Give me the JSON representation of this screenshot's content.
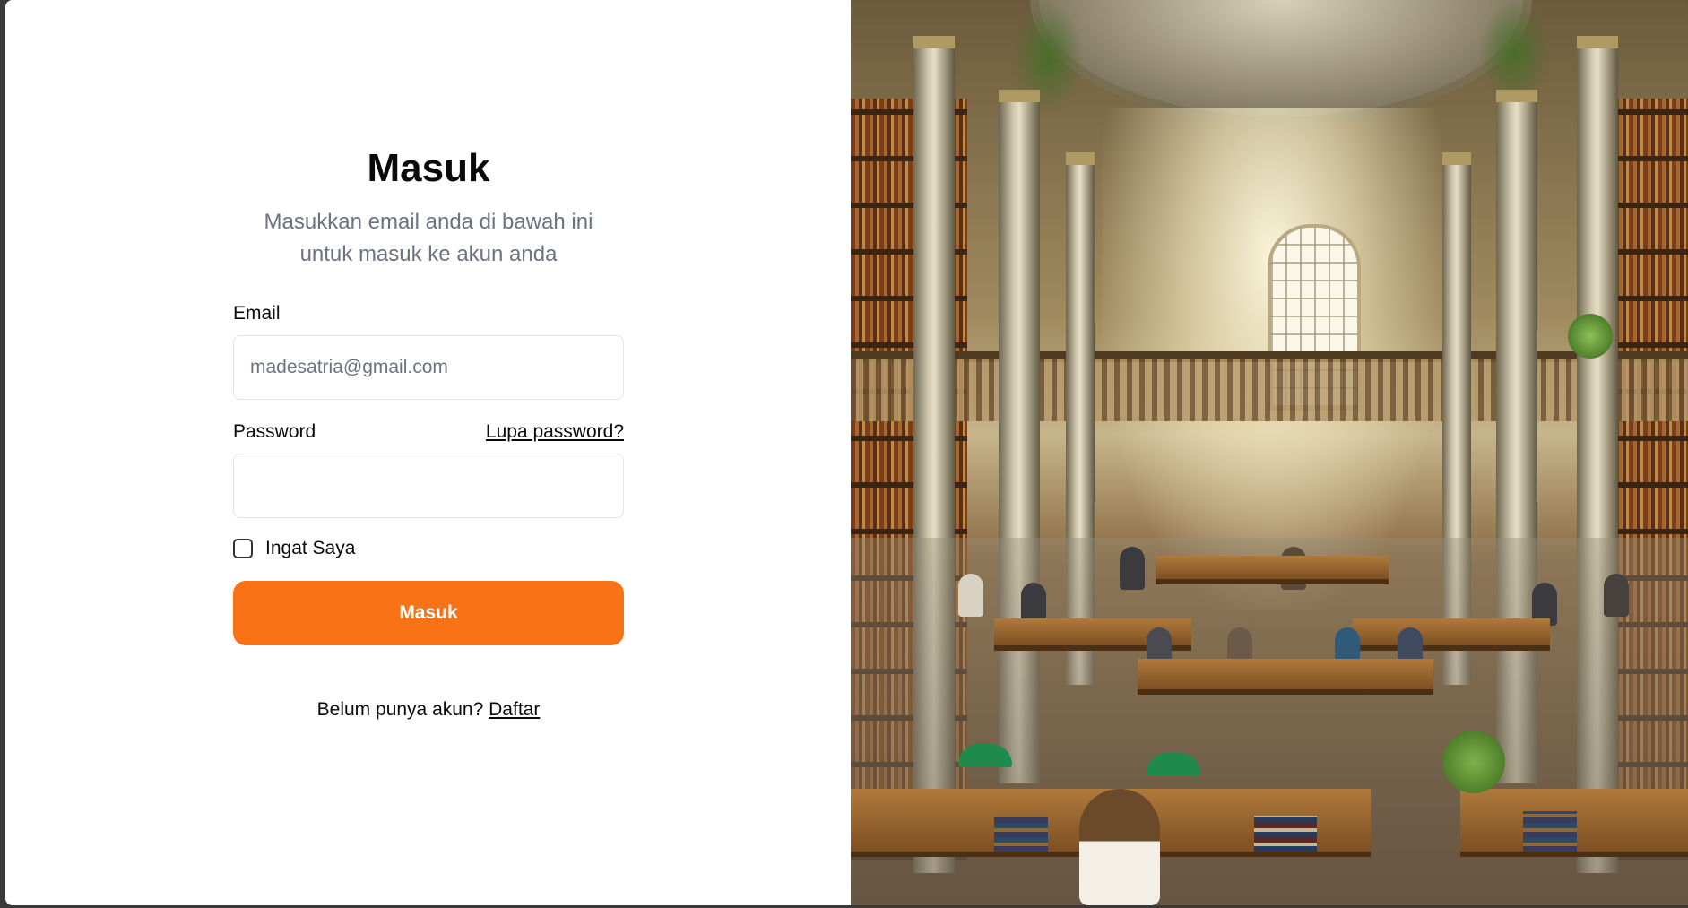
{
  "login": {
    "title": "Masuk",
    "subtitle": "Masukkan email anda di bawah ini untuk masuk ke akun anda",
    "email_label": "Email",
    "email_placeholder": "madesatria@gmail.com",
    "email_value": "",
    "password_label": "Password",
    "forgot_label": "Lupa password?",
    "password_value": "",
    "remember_label": "Ingat Saya",
    "remember_checked": false,
    "submit_label": "Masuk",
    "signup_prompt": "Belum punya akun?",
    "signup_link": "Daftar"
  },
  "colors": {
    "accent": "#f97316",
    "text": "#0a0a0a",
    "muted": "#6b7280",
    "border": "#e4e4e7"
  },
  "hero_image": {
    "icon": "library-reading-room-illustration"
  }
}
